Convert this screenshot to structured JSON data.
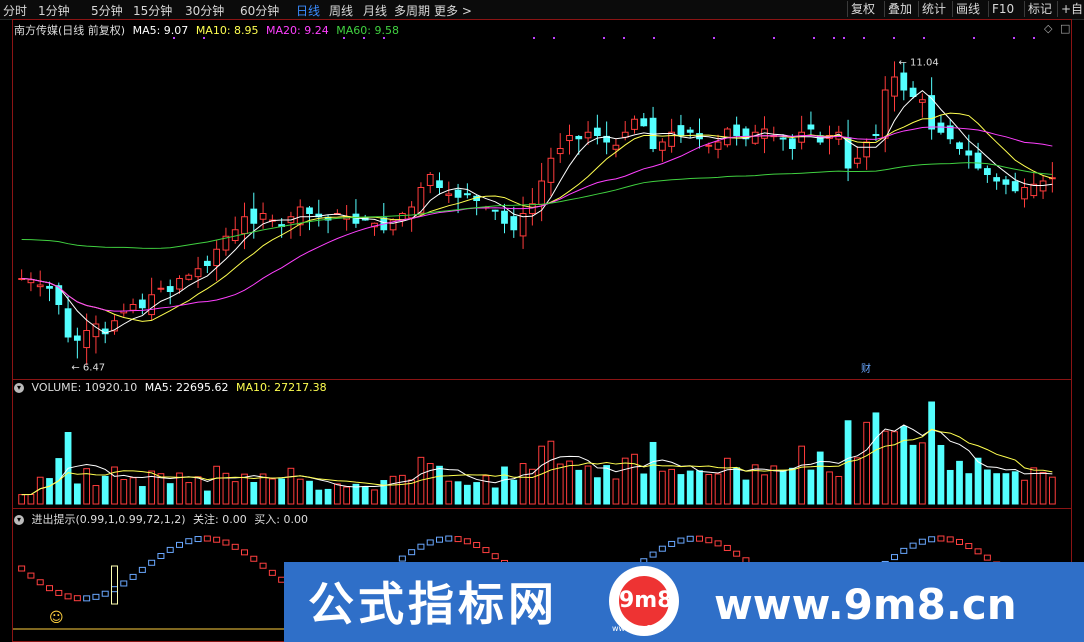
{
  "toolbar": {
    "timeframes": [
      "分时",
      "1分钟",
      "5分钟",
      "15分钟",
      "30分钟",
      "60分钟",
      "日线",
      "周线",
      "月线",
      "多周期",
      "更多 >"
    ],
    "active": "日线",
    "right": [
      "复权",
      "叠加",
      "统计",
      "画线",
      "F10",
      "标记",
      "+自"
    ]
  },
  "main": {
    "title": "南方传媒(日线 前复权)",
    "ma5": "MA5: 9.07",
    "ma10": "MA10: 8.95",
    "ma20": "MA20: 9.24",
    "ma60": "MA60: 9.58",
    "high_label": "11.04",
    "low_label": "6.47",
    "fin_label": "财",
    "expand_icon": "◇",
    "close_icon": "□",
    "colors": {
      "up": "#ff3c3c",
      "down": "#54ffff",
      "ma5": "#ffffff",
      "ma10": "#ffff50",
      "ma20": "#ff40ff",
      "ma60": "#40d040"
    }
  },
  "volume": {
    "title": "VOLUME: 10920.10",
    "ma5": "MA5: 22695.62",
    "ma10": "MA10: 27217.38"
  },
  "indicator": {
    "title": "进出提示(0.99,1,0.99,72,1,2)",
    "focus": "关注: 0.00",
    "buy": "买入: 0.00",
    "icon": "☺"
  },
  "watermark": {
    "cn": "公式指标网",
    "url": "www.9m8.cn",
    "logo": "9m8",
    "sub": "www.9m8.cn"
  },
  "chart_data": {
    "type": "candlestick",
    "ylim": [
      6.2,
      11.4
    ],
    "high": 11.04,
    "low": 6.47,
    "closes": [
      7.7,
      7.68,
      7.6,
      7.55,
      7.3,
      6.8,
      6.75,
      6.9,
      7.0,
      6.85,
      7.05,
      7.2,
      7.3,
      7.25,
      7.45,
      7.55,
      7.5,
      7.7,
      7.75,
      7.85,
      7.9,
      8.15,
      8.35,
      8.45,
      8.65,
      8.55,
      8.7,
      8.6,
      8.5,
      8.65,
      8.8,
      8.7,
      8.65,
      8.6,
      8.7,
      8.65,
      8.55,
      8.6,
      8.55,
      8.45,
      8.6,
      8.7,
      8.8,
      9.1,
      9.3,
      9.1,
      9.0,
      8.95,
      9.0,
      8.9,
      8.8,
      8.75,
      8.55,
      8.45,
      8.7,
      8.85,
      9.2,
      9.55,
      9.7,
      9.9,
      9.85,
      9.95,
      9.9,
      9.8,
      9.75,
      9.95,
      10.15,
      10.05,
      9.7,
      9.8,
      9.95,
      9.9,
      9.95,
      9.85,
      9.75,
      9.8,
      10.0,
      9.9,
      9.85,
      9.95,
      10.0,
      9.9,
      9.85,
      9.7,
      9.95,
      10.0,
      9.8,
      9.9,
      9.95,
      9.4,
      9.55,
      9.8,
      9.9,
      10.6,
      10.8,
      10.6,
      10.5,
      10.45,
      10.0,
      9.95,
      9.85,
      9.7,
      9.6,
      9.4,
      9.3,
      9.2,
      9.15,
      9.05,
      9.1,
      9.15,
      9.2,
      9.25
    ]
  }
}
